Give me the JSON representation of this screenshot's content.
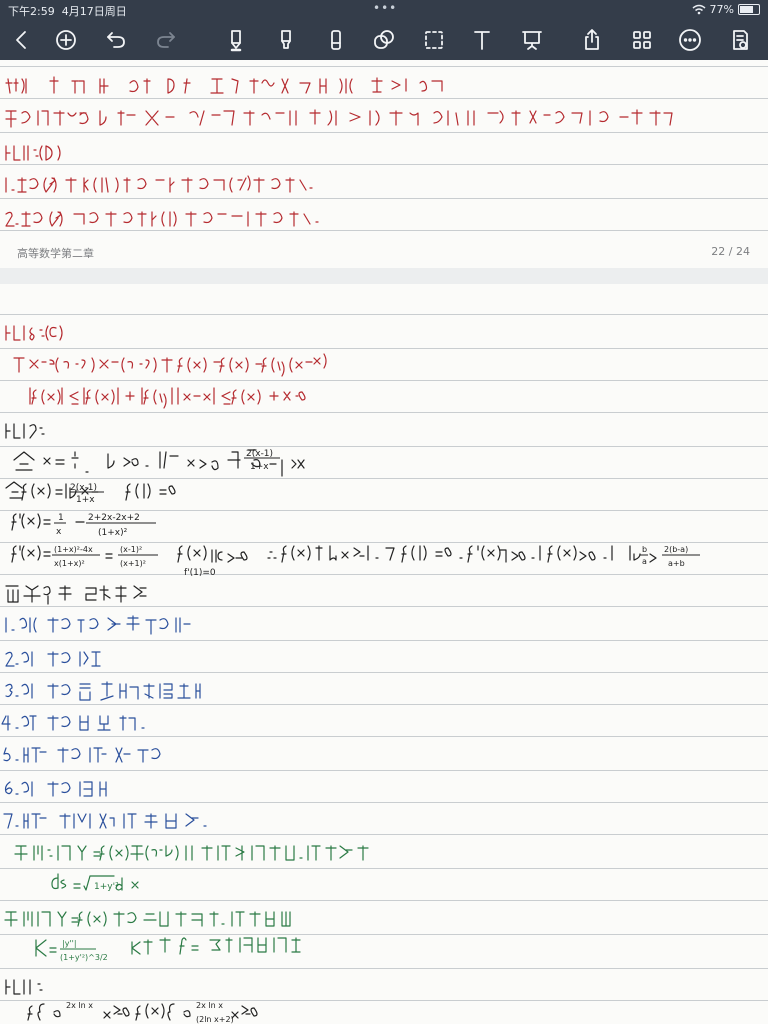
{
  "status_bar": {
    "time": "下午2:59",
    "date": "4月17日周日",
    "battery": "77%"
  },
  "toolbar": {
    "back_icon": "chevron-left-icon",
    "add_icon": "plus-circle-icon",
    "undo_icon": "undo-icon",
    "redo_icon": "redo-icon",
    "pen_icon": "pen-icon",
    "highlighter_icon": "highlighter-icon",
    "eraser_icon": "eraser-icon",
    "lasso_icon": "lasso-icon",
    "selection_icon": "selection-box-icon",
    "text_icon": "text-tool-icon",
    "presentation_icon": "presentation-icon",
    "share_icon": "share-icon",
    "pages_icon": "grid-pages-icon",
    "more_icon": "more-icon",
    "reading_mode_icon": "reading-mode-icon",
    "accent_color": "#343d4a"
  },
  "page1": {
    "footer_title": "高等数学第二章",
    "page_indicator": "22 / 24",
    "lines": [
      "若 f(1)=1 则取 x0=1∈[0,1],使 f(1)=0. 即 f(1)=1 完成证明",
      "除此之外,有 f(0)>0. f(1)<0, 由零点定理可知 存在 x0∈[0,1], 使 f(x0)=0. 即 f(x0)=x0. 证毕",
      "例7:(D)",
      "1.如果 f(x) 有 k(k≥2) 个零点, 则 f'(x) 至少有 (k-1) 个零点.",
      "2.如果 f'(x) 没有零点, 则 f(x) 至多有 1 个零点."
    ]
  },
  "page2": {
    "lines": [
      "例8:(C)",
      "取 x0∈(0,δ), x∈(0,δ) 有 f(x)=f(x0)+f'(ξ)(x-x0)",
      "|f(x)|≤|f(x0)|+|f'(ξ)||x-x0|≤f(x0)+M·δ",
      "例9:",
      "令 x=b/a, b>a. 则 x>0 原式: ln x > 2(x-1)/(1+x)",
      "令 f(x)=ln x - 2(x-1)/(1+x)  f(1)=0",
      "f'(x)=1/x - (2+2x-2x+2)/(1+x)²",
      "f'(x)=((1+x)²-4x)/(x(1+x)²)=(x-1)²/(x+1)²  f'(x)恒≥0  f(1)=0  ∵ f(x) 中 x>1. 而 f(1)=0, f'(x)恒>0. 则 f(x)>0. 则 ln(b/a)>2(b-a)/(a+b)",
      "第四节 导数应用",
      "1.函数的单调性",
      "2.函数的极值",
      "3.函数的最大值和最小值",
      "4.曲线的凹凸性.",
      "5.曲线渐近线",
      "6.函数的作图",
      "7.曲线的弧微分和曲率.",
      "定义:设 y=f(x) 在 (a,b) 内有连续导数, 则有弧微分",
      "ds=√(1+y'²) dx",
      "定义:设 y=f(x) 有二阶导数. 则有曲率",
      "K=|y''|/(1+y'²)^(3/2)  称 ρ=1/K 为曲率半径",
      "例1:",
      "f(x)={e^(2x ln x), x>0  f'(x)={e^(2x ln x)·(2ln x+2), x>0"
    ]
  },
  "colors": {
    "ink_red": "#b52a2f",
    "ink_black": "#222222",
    "ink_blue": "#2a4f9c",
    "ink_green": "#2a7a44",
    "paper": "#fbfbf9",
    "page_gap": "#eceeef"
  }
}
